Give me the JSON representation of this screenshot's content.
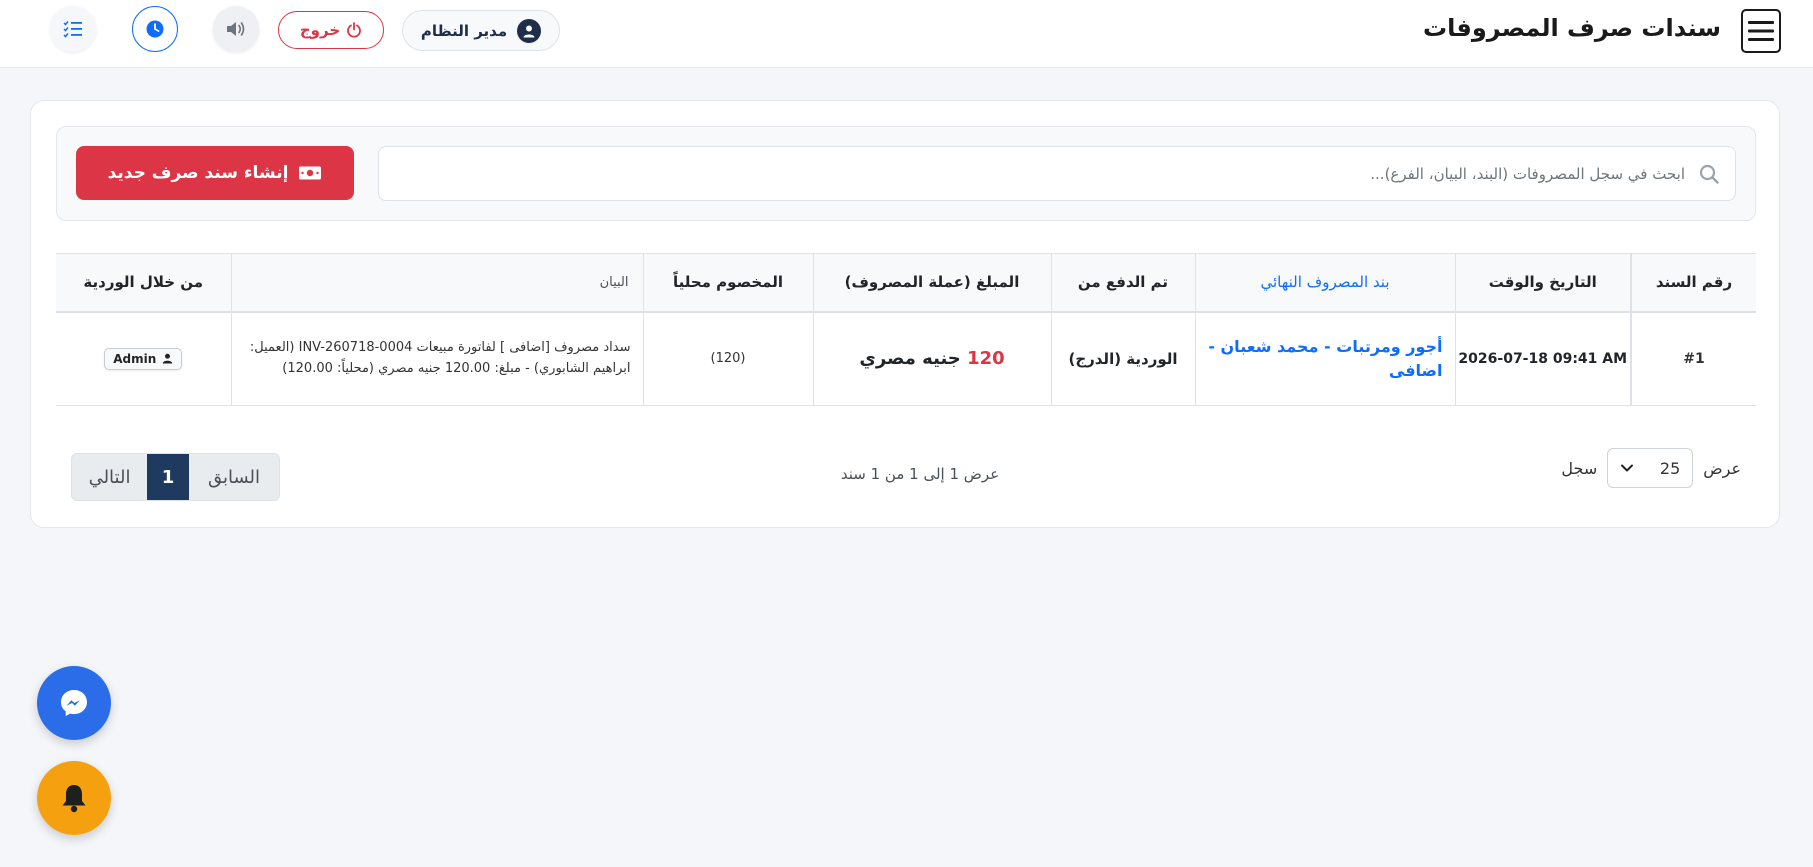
{
  "header": {
    "title": "سندات صرف المصروفات",
    "user_name": "مدير النظام",
    "logout_label": "خروج"
  },
  "toolbar": {
    "search_placeholder": "ابحث في سجل المصروفات (البند، البيان، الفرع)...",
    "create_label": "إنشاء سند صرف جديد"
  },
  "table": {
    "columns": {
      "voucher_no": "رقم السند",
      "datetime": "التاريخ والوقت",
      "category": "بند المصروف النهائي",
      "paid_from": "تم الدفع من",
      "amount": "المبلغ (عملة المصروف)",
      "deducted_local": "المخصوم محلياً",
      "description": "البيان",
      "shift_user": "من خلال الوردية"
    },
    "rows": [
      {
        "voucher_no": "#1",
        "datetime": "2026-07-18 09:41 AM",
        "category": "أجور ومرتبات - محمد شعبان - اضافى",
        "paid_from": "الوردية (الدرج)",
        "amount_value": "120",
        "amount_currency": "جنيه مصري",
        "deducted_local": "(120)",
        "description": "سداد مصروف [اضافى ] لفاتورة مبيعات INV-260718-0004 (العميل: ابراهيم الشابوري) - مبلغ: 120.00 جنيه مصري (محلياً: 120.00)",
        "shift_user": "Admin"
      }
    ]
  },
  "footer": {
    "show_label": "عرض",
    "page_length": "25",
    "records_label": "سجل",
    "info": "عرض 1 إلى 1 من 1 سند",
    "prev_label": "السابق",
    "current_page": "1",
    "next_label": "التالي"
  },
  "colors": {
    "danger": "#dc3545",
    "primary": "#0d6efd",
    "navy": "#1e3a5f",
    "messenger": "#2b6de8",
    "bell": "#f5a10f"
  }
}
